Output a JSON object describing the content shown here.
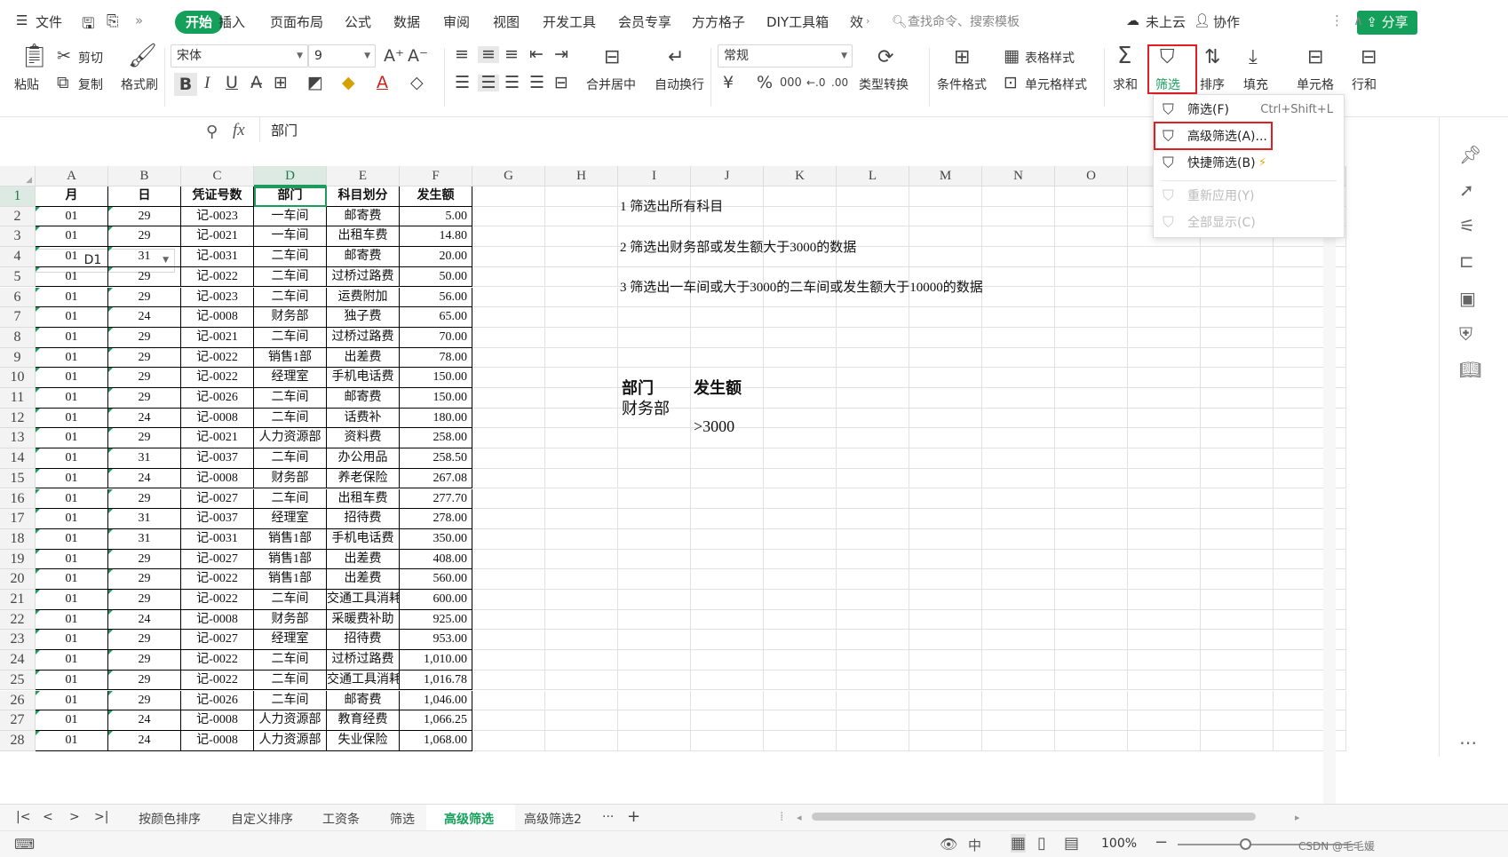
{
  "menubar": {
    "file": "文件",
    "tabs": [
      "开始",
      "插入",
      "页面布局",
      "公式",
      "数据",
      "审阅",
      "视图",
      "开发工具",
      "会员专享",
      "方方格子",
      "DIY工具箱",
      "效"
    ],
    "search_placeholder": "查找命令、搜索模板",
    "cloud": "未上云",
    "collab": "协作",
    "share": "分享"
  },
  "ribbon": {
    "paste": "粘贴",
    "cut": "剪切",
    "copy": "复制",
    "format_painter": "格式刷",
    "font_name": "宋体",
    "font_size": "9",
    "merge_center": "合并居中",
    "wrap_text": "自动换行",
    "number_format": "常规",
    "type_convert": "类型转换",
    "conditional_format": "条件格式",
    "table_style": "表格样式",
    "cell_style": "单元格样式",
    "sum": "求和",
    "filter": "筛选",
    "sort": "排序",
    "fill": "填充",
    "cell": "单元格",
    "rowcol": "行和"
  },
  "formula_bar": {
    "name_box": "D1",
    "fx": "fx",
    "content": "部门"
  },
  "filter_menu": {
    "items": [
      {
        "label": "筛选(F)",
        "shortcut": "Ctrl+Shift+L",
        "enabled": true
      },
      {
        "label": "高级筛选(A)...",
        "shortcut": "",
        "enabled": true
      },
      {
        "label": "快捷筛选(B)",
        "shortcut": "",
        "enabled": true
      },
      {
        "label": "重新应用(Y)",
        "shortcut": "",
        "enabled": false
      },
      {
        "label": "全部显示(C)",
        "shortcut": "",
        "enabled": false
      }
    ]
  },
  "sheet": {
    "columns": [
      "A",
      "B",
      "C",
      "D",
      "E",
      "F",
      "G",
      "H",
      "I",
      "J",
      "K",
      "L",
      "M",
      "N",
      "O"
    ],
    "selected_column": "D",
    "selected_row": "1",
    "header": [
      "月",
      "日",
      "凭证号数",
      "部门",
      "科目划分",
      "发生额"
    ],
    "rows": [
      [
        "01",
        "29",
        "记-0023",
        "一车间",
        "邮寄费",
        "5.00"
      ],
      [
        "01",
        "29",
        "记-0021",
        "一车间",
        "出租车费",
        "14.80"
      ],
      [
        "01",
        "31",
        "记-0031",
        "二车间",
        "邮寄费",
        "20.00"
      ],
      [
        "01",
        "29",
        "记-0022",
        "二车间",
        "过桥过路费",
        "50.00"
      ],
      [
        "01",
        "29",
        "记-0023",
        "二车间",
        "运费附加",
        "56.00"
      ],
      [
        "01",
        "24",
        "记-0008",
        "财务部",
        "独子费",
        "65.00"
      ],
      [
        "01",
        "29",
        "记-0021",
        "二车间",
        "过桥过路费",
        "70.00"
      ],
      [
        "01",
        "29",
        "记-0022",
        "销售1部",
        "出差费",
        "78.00"
      ],
      [
        "01",
        "29",
        "记-0022",
        "经理室",
        "手机电话费",
        "150.00"
      ],
      [
        "01",
        "29",
        "记-0026",
        "二车间",
        "邮寄费",
        "150.00"
      ],
      [
        "01",
        "24",
        "记-0008",
        "二车间",
        "话费补",
        "180.00"
      ],
      [
        "01",
        "29",
        "记-0021",
        "人力资源部",
        "资料费",
        "258.00"
      ],
      [
        "01",
        "31",
        "记-0037",
        "二车间",
        "办公用品",
        "258.50"
      ],
      [
        "01",
        "24",
        "记-0008",
        "财务部",
        "养老保险",
        "267.08"
      ],
      [
        "01",
        "29",
        "记-0027",
        "二车间",
        "出租车费",
        "277.70"
      ],
      [
        "01",
        "31",
        "记-0037",
        "经理室",
        "招待费",
        "278.00"
      ],
      [
        "01",
        "31",
        "记-0031",
        "销售1部",
        "手机电话费",
        "350.00"
      ],
      [
        "01",
        "29",
        "记-0027",
        "销售1部",
        "出差费",
        "408.00"
      ],
      [
        "01",
        "29",
        "记-0022",
        "销售1部",
        "出差费",
        "560.00"
      ],
      [
        "01",
        "29",
        "记-0022",
        "二车间",
        "交通工具消耗",
        "600.00"
      ],
      [
        "01",
        "24",
        "记-0008",
        "财务部",
        "采暖费补助",
        "925.00"
      ],
      [
        "01",
        "29",
        "记-0027",
        "经理室",
        "招待费",
        "953.00"
      ],
      [
        "01",
        "29",
        "记-0022",
        "二车间",
        "过桥过路费",
        "1,010.00"
      ],
      [
        "01",
        "29",
        "记-0022",
        "二车间",
        "交通工具消耗",
        "1,016.78"
      ],
      [
        "01",
        "29",
        "记-0026",
        "二车间",
        "邮寄费",
        "1,046.00"
      ],
      [
        "01",
        "24",
        "记-0008",
        "人力资源部",
        "教育经费",
        "1,066.25"
      ],
      [
        "01",
        "24",
        "记-0008",
        "人力资源部",
        "失业保险",
        "1,068.00"
      ]
    ],
    "notes": [
      "1 筛选出所有科目",
      "2 筛选出财务部或发生额大于3000的数据",
      "3 筛选出一车间或大于3000的二车间或发生额大于10000的数据"
    ],
    "criteria": {
      "h1": "部门",
      "h2": "发生额",
      "v1": "财务部",
      "v2": ">3000"
    }
  },
  "sheet_tabs": {
    "tabs": [
      "按颜色排序",
      "自定义排序",
      "工资条",
      "筛选",
      "高级筛选",
      "高级筛选2"
    ],
    "active": "高级筛选",
    "more": "···",
    "add": "+"
  },
  "status": {
    "zoom": "100%",
    "watermark": "CSDN @毛毛媛"
  }
}
